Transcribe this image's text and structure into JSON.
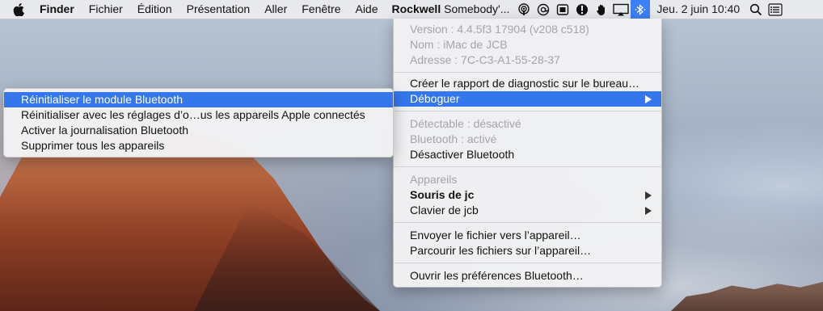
{
  "menubar": {
    "apple_icon": "apple-logo-icon",
    "app_name": "Finder",
    "menus": [
      "Fichier",
      "Édition",
      "Présentation",
      "Aller",
      "Fenêtre",
      "Aide"
    ],
    "now_playing": {
      "artist": "Rockwell",
      "title": "Somebody'..."
    },
    "status_icons": [
      "podcast-icon",
      "at-sign-icon",
      "screen-record-icon",
      "info-circle-icon",
      "hand-icon",
      "airplay-display-icon",
      "bluetooth-icon"
    ],
    "date": "Jeu. 2 juin",
    "time": "10:40",
    "spotlight_icon": "search-icon",
    "notification_icon": "list-icon"
  },
  "bluetooth_menu": {
    "version": "Version : 4.4.5f3 17904 (v208 c518)",
    "name": "Nom : iMac de JCB",
    "address": "Adresse : 7C-C3-A1-55-28-37",
    "diagnostic_report": "Créer le rapport de diagnostic sur le bureau…",
    "debug": "Déboguer",
    "discoverable": "Détectable : désactivé",
    "bluetooth_status": "Bluetooth : activé",
    "disable_bluetooth": "Désactiver Bluetooth",
    "devices_header": "Appareils",
    "device_mouse": "Souris de jc",
    "device_keyboard": "Clavier de jcb",
    "send_file": "Envoyer le fichier vers l’appareil…",
    "browse_files": "Parcourir les fichiers sur l’appareil…",
    "open_prefs": "Ouvrir les préférences Bluetooth…"
  },
  "debug_submenu": {
    "items": [
      "Réinitialiser le module Bluetooth",
      "Réinitialiser avec les réglages d’o…us les appareils Apple connectés",
      "Activer la journalisation Bluetooth",
      "Supprimer tous les appareils"
    ]
  },
  "colors": {
    "highlight": "#3477ec",
    "status_active": "#3d7ff6"
  }
}
